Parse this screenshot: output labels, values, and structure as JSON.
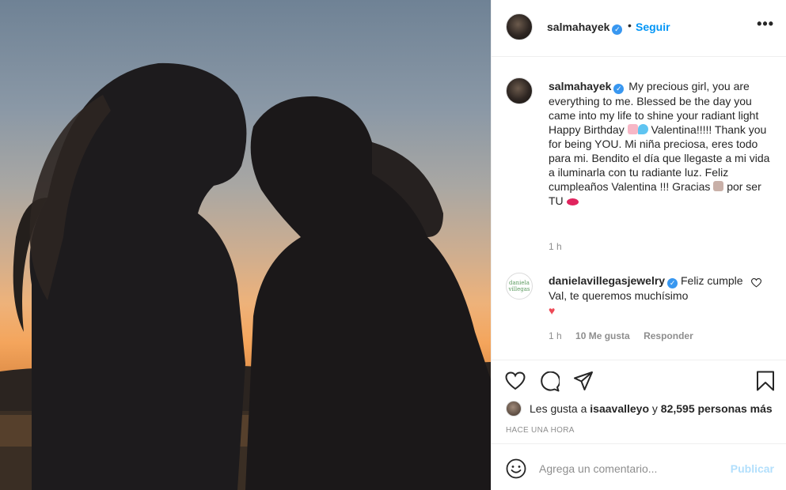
{
  "post": {
    "photo_icon": "mother-daughter-silhouette-photo",
    "header": {
      "username": "salmahayek",
      "verified_icon": "verified-badge-icon",
      "separator": "•",
      "follow_label": "Seguir",
      "more_label": "•••"
    },
    "caption": {
      "username": "salmahayek",
      "text_1": "My precious girl, you are everything to me. Blessed be the day you came into my life to shine your radiant light Happy Birthday",
      "text_2": "Valentina!!!!! Thank you for being YOU. Mi niña preciosa, eres todo para mi. Bendito el día que llegaste a mi vida a iluminarla con tu radiante luz. Feliz cumpleaños Valentina !!! Gracias",
      "text_3": "por ser TU",
      "emojis": [
        "birthday-cake-emoji",
        "balloon-emoji",
        "hands-emoji",
        "kiss-lips-emoji"
      ],
      "time": "1 h"
    },
    "comments": [
      {
        "avatar_text": "daniela villegas",
        "username": "danielavillegasjewelry",
        "text": "Feliz cumple Val, te queremos muchísimo",
        "emoji": "red-heart-emoji",
        "time": "1 h",
        "likes": "10 Me gusta",
        "reply_label": "Responder"
      }
    ],
    "actions": {
      "like_icon": "heart-outline-icon",
      "comment_icon": "comment-bubble-icon",
      "share_icon": "paper-plane-icon",
      "save_icon": "bookmark-icon"
    },
    "likes": {
      "prefix": "Les gusta a",
      "user": "isaavalleyo",
      "connector": "y",
      "count": "82,595 personas más"
    },
    "posted_time": "HACE UNA HORA",
    "add_comment": {
      "placeholder": "Agrega un comentario...",
      "publish_label": "Publicar"
    }
  },
  "colors": {
    "accent": "#0095f6",
    "verified": "#3897f0",
    "publish_disabled": "#b2dffc",
    "heart": "#ed4956",
    "muted_text": "#8e8e8e"
  }
}
